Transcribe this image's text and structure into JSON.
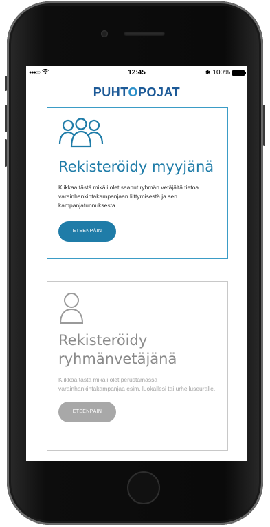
{
  "status_bar": {
    "signal": "●●●○○",
    "time": "12:45",
    "bluetooth": "✱",
    "battery_percent": "100%"
  },
  "brand": {
    "logo_text_left": "PUHT",
    "logo_text_mid": "O",
    "logo_text_right": "POJAT",
    "accent_color": "#1d5a97"
  },
  "cards": [
    {
      "icon": "group-icon",
      "title": "Rekisteröidy myyjänä",
      "text": "Klikkaa tästä mikäli olet saanut ryhmän vetäjältä tietoa varainhankintakampanjaan liittymisestä ja sen kampanjatunnuksesta.",
      "button": "ETEENPÄIN"
    },
    {
      "icon": "user-icon",
      "title": "Rekisteröidy ryhmänvetäjänä",
      "text": "Klikkaa tästä mikäli olet perustamassa varainhankintakampanjaa esim. luokallesi tai urheiluseuralle.",
      "button": "ETEENPÄIN"
    }
  ]
}
